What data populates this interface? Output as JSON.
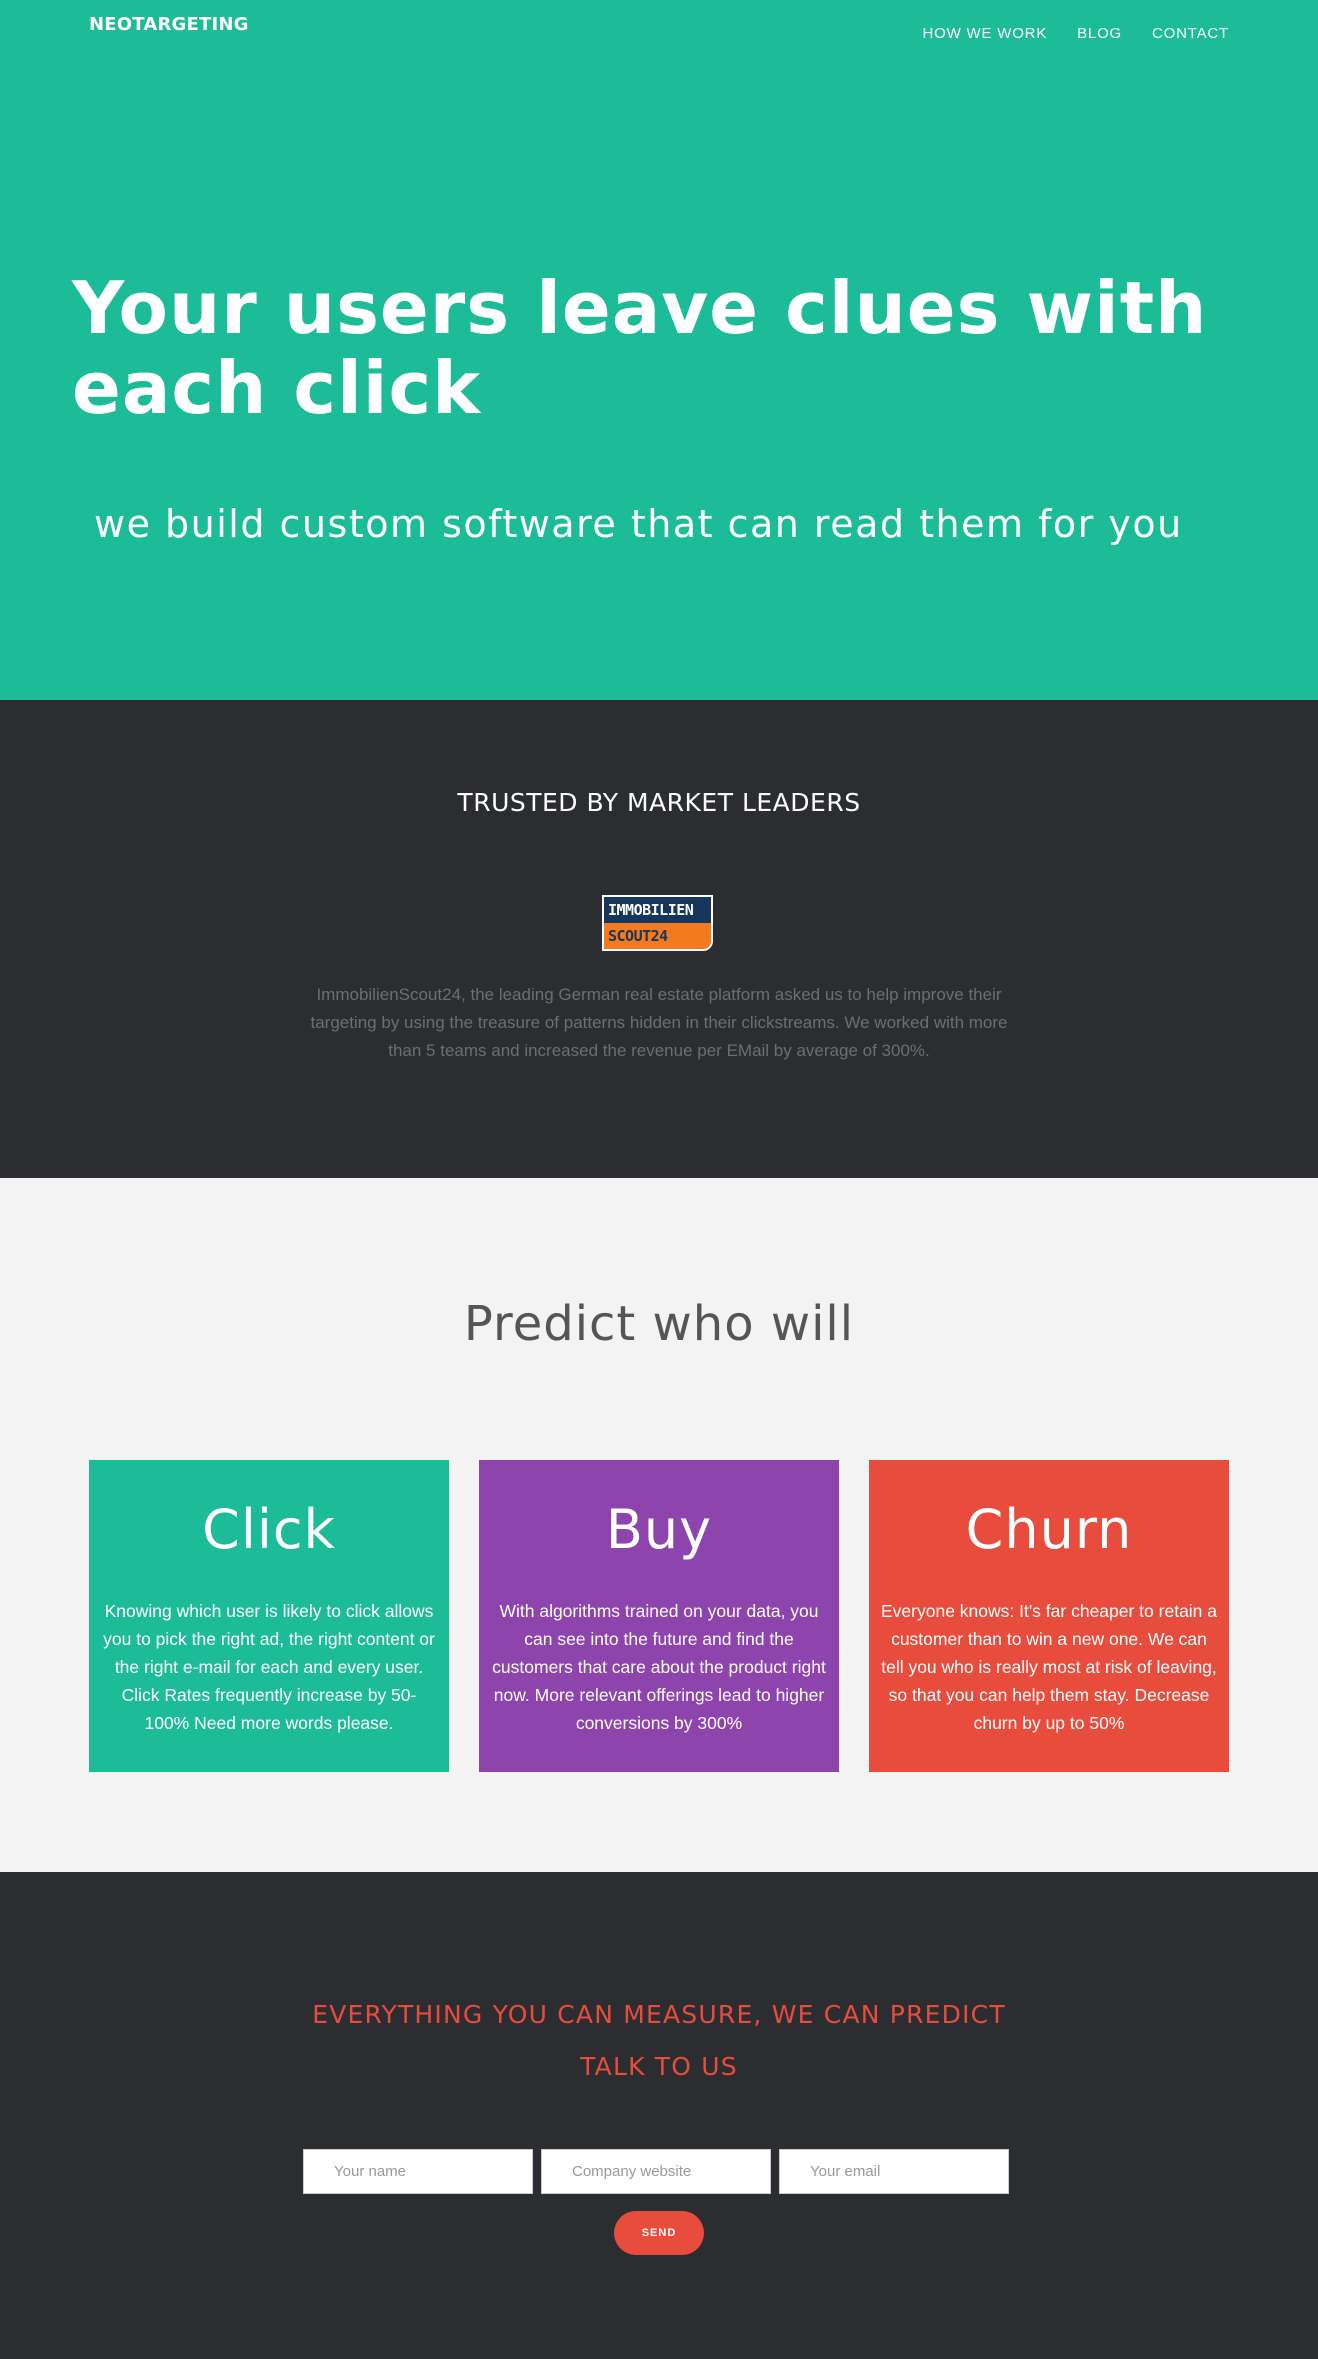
{
  "brand": "NEOTARGETING",
  "nav": [
    "HOW WE WORK",
    "BLOG",
    "CONTACT"
  ],
  "hero": {
    "title": "Your users leave clues with each click",
    "subtitle": "we build custom software that can read them for you"
  },
  "trusted": {
    "title": "TRUSTED BY MARKET LEADERS",
    "logo_top": "IMMOBILIEN",
    "logo_bottom": "SCOUT24",
    "text": "ImmobilienScout24, the leading German real estate platform asked us to help improve their targeting by using the treasure of patterns hidden in their clickstreams. We worked with more than 5 teams and increased the revenue per EMail by average of 300%."
  },
  "predict": {
    "title": "Predict who will",
    "cards": [
      {
        "title": "Click",
        "color": "#1dbc99",
        "text": "Knowing which user is likely to click allows you to pick the right ad, the right content or the right e-mail for each and every user. Click Rates frequently increase by 50-100% Need more words please."
      },
      {
        "title": "Buy",
        "color": "#8e44ad",
        "text": "With algorithms trained on your data, you can see into the future and find the customers that care about the product right now. More relevant offerings lead to higher conversions by 300%"
      },
      {
        "title": "Churn",
        "color": "#e74c3c",
        "text": "Everyone knows: It's far cheaper to retain a customer than to win a new one. We can tell you who is really most at risk of leaving, so that you can help them stay. Decrease churn by up to 50%"
      }
    ]
  },
  "contact": {
    "headline": "EVERYTHING YOU CAN MEASURE, WE CAN PREDICT",
    "cta": "TALK TO US",
    "name_placeholder": "Your name",
    "website_placeholder": "Company website",
    "email_placeholder": "Your email",
    "send_label": "SEND"
  },
  "colors": {
    "accent_green": "#1dbc99",
    "accent_purple": "#8e44ad",
    "accent_red": "#e74c3c",
    "dark": "#2b2d30"
  }
}
